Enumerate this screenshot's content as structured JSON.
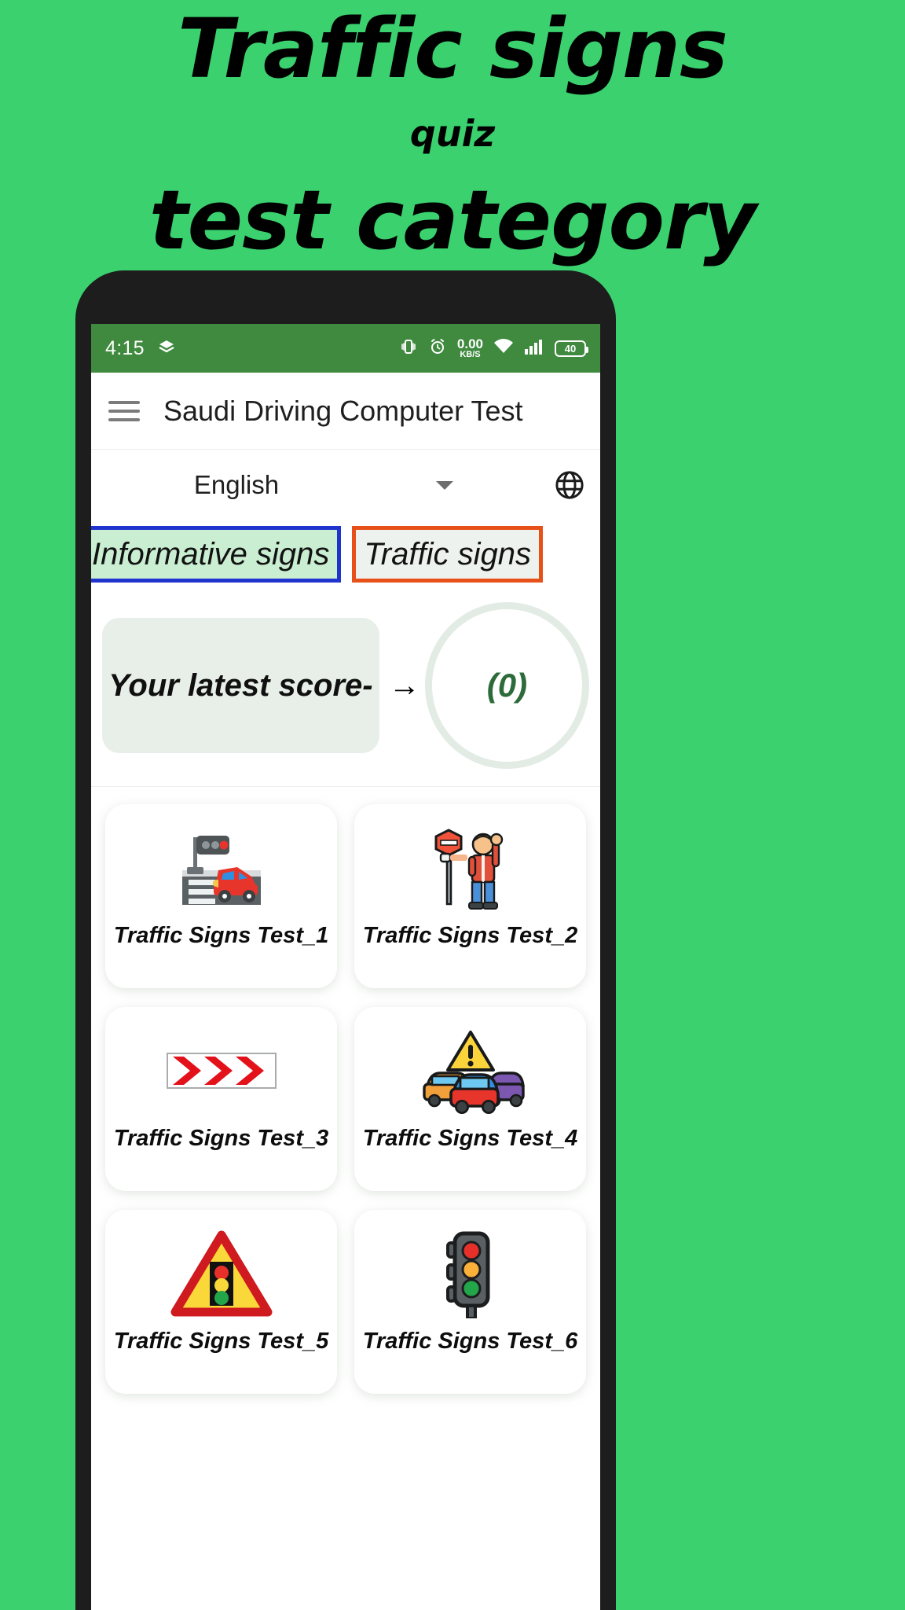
{
  "promo": {
    "title": "Traffic signs",
    "subtitle": "quiz",
    "title2": "test category",
    "background_color": "#3ad16e"
  },
  "phone": {
    "statusbar": {
      "time": "4:15",
      "left_icons": [
        "layers-icon"
      ],
      "network_speed_value": "0.00",
      "network_speed_unit": "KB/S",
      "right_icons": [
        "vibrate-icon",
        "alarm-icon",
        "wifi-icon",
        "signal-icon"
      ],
      "battery_level": "40",
      "background_color": "#3f8a3f"
    },
    "appbar": {
      "menu_icon": "hamburger-icon",
      "title": "Saudi Driving Computer Test"
    },
    "language": {
      "selected": "English",
      "dropdown_icon": "chevron-down-icon",
      "globe_icon": "globe-icon"
    },
    "tabs": [
      {
        "label": "Informative signs",
        "active": true,
        "border_color": "#1f33cf",
        "fill_color": "#c9eed1"
      },
      {
        "label": "Traffic signs",
        "active": false,
        "border_color": "#e8501a",
        "fill_color": "#eef2ee"
      }
    ],
    "score": {
      "label": "Your latest score-",
      "arrow": "→",
      "value": "(0)",
      "value_color": "#2d6b3a"
    },
    "tests": [
      {
        "label": "Traffic Signs Test_1",
        "icon": "traffic-light-crosswalk-car-icon"
      },
      {
        "label": "Traffic Signs Test_2",
        "icon": "traffic-officer-stop-sign-icon"
      },
      {
        "label": "Traffic Signs Test_3",
        "icon": "red-chevron-arrow-sign-icon"
      },
      {
        "label": "Traffic Signs Test_4",
        "icon": "warning-triangle-traffic-jam-icon"
      },
      {
        "label": "Traffic Signs Test_5",
        "icon": "warning-triangle-traffic-light-icon"
      },
      {
        "label": "Traffic Signs Test_6",
        "icon": "traffic-light-icon"
      }
    ]
  }
}
